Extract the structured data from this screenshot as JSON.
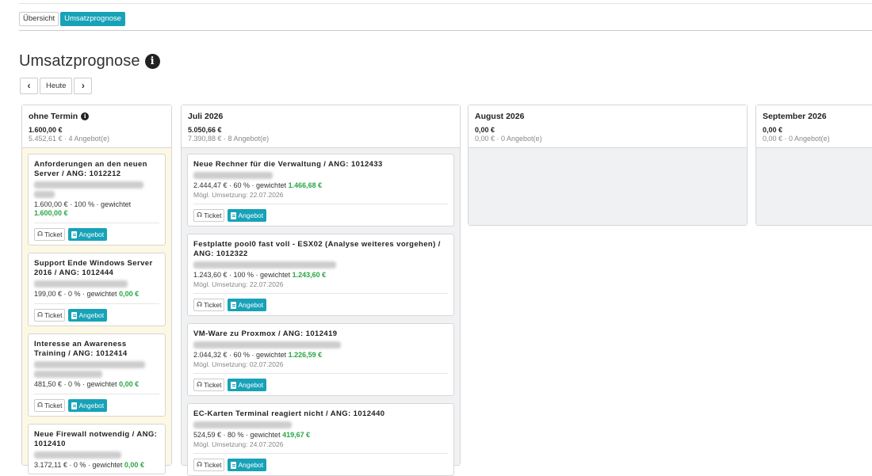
{
  "tabs": [
    {
      "label": "Übersicht",
      "active": false
    },
    {
      "label": "Umsatzprognose",
      "active": true
    }
  ],
  "page": {
    "title": "Umsatzprognose",
    "nav": {
      "prev": "‹",
      "today": "Heute",
      "next": "›"
    }
  },
  "buttons": {
    "ticket": "Ticket",
    "offer": "Angebot"
  },
  "columns": [
    {
      "title": "ohne Termin",
      "sum": "1.600,00 €",
      "sub": "5.452,61 € · 4 Angebot(e)",
      "cards": [
        {
          "title": "Anforderungen an den neuen Server / ANG: 1012212",
          "line": "1.600,00 € · 100 % · gewichtet",
          "weighted": "1.600,00 €"
        },
        {
          "title": "Support Ende Windows Server 2016 / ANG: 1012444",
          "line": "199,00 € · 0 % · gewichtet",
          "weighted": "0,00 €"
        },
        {
          "title": "Interesse an Awareness Training / ANG: 1012414",
          "line": "481,50 € · 0 % · gewichtet",
          "weighted": "0,00 €"
        },
        {
          "title": "Neue Firewall notwendig / ANG: 1012410",
          "line": "3.172,11 € · 0 % · gewichtet",
          "weighted": "0,00 €"
        }
      ]
    },
    {
      "title": "Juli 2026",
      "sum": "5.050,66 €",
      "sub": "7.390,88 € · 8 Angebot(e)",
      "cards": [
        {
          "title": "Neue Rechner für die Verwaltung / ANG: 1012433",
          "line": "2.444,47 € · 60 % · gewichtet",
          "weighted": "1.466,68 €",
          "date": "Mögl. Umsetzung: 22.07.2026"
        },
        {
          "title": "Festplatte pool0 fast voll - ESX02 (Analyse weiteres vorgehen) / ANG: 1012322",
          "line": "1.243,60 € · 100 % · gewichtet",
          "weighted": "1.243,60 €",
          "date": "Mögl. Umsetzung: 22.07.2026"
        },
        {
          "title": "VM-Ware zu Proxmox / ANG: 1012419",
          "line": "2.044,32 € · 60 % · gewichtet",
          "weighted": "1.226,59 €",
          "date": "Mögl. Umsetzung: 02.07.2026"
        },
        {
          "title": "EC-Karten Terminal reagiert nicht / ANG: 1012440",
          "line": "524,59 € · 80 % · gewichtet",
          "weighted": "419,67 €",
          "date": "Mögl. Umsetzung: 24.07.2026"
        }
      ]
    },
    {
      "title": "August 2026",
      "sum": "0,00 €",
      "sub": "0,00 € · 0 Angebot(e)"
    },
    {
      "title": "September 2026",
      "sum": "0,00 €",
      "sub": "0,00 € · 0 Angebot(e)"
    }
  ],
  "colors": {
    "accent": "#17a2b8",
    "positive": "#28a745",
    "nodate_bg": "#fdf8e4"
  },
  "icons": [
    "info-icon",
    "chevron-left-icon",
    "chevron-right-icon",
    "headset-icon",
    "document-icon"
  ]
}
